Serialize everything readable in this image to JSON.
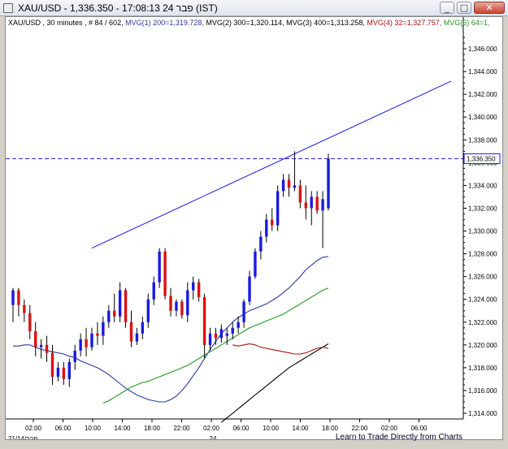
{
  "window": {
    "title": "XAU/USD - 1,336.350 - 17:08:13  פבר 24 (IST)"
  },
  "indicators": {
    "symbol": "XAU/USD , 30 minutes , # 84 / 602,",
    "mvg1": "MVG(1) 200=1,319.728,",
    "mvg2": "MVG(2) 300=1,320.114,",
    "mvg3": "MVG(3) 400=1,313.258,",
    "mvg4": "MVG(4) 32=1,327.757,",
    "mvg5": "MVG(5) 64=1,"
  },
  "colors": {
    "mvg1": "#2a3aa0",
    "mvg2": "#000000",
    "mvg3": "#000000",
    "mvg4": "#aa1111",
    "mvg5": "#229922",
    "up": "#1a1adf",
    "down": "#dd1111"
  },
  "price_label": "1,336.350",
  "bottom_link": "Learn to Trade Directly from Charts",
  "chart_data": {
    "type": "candlestick",
    "price_axis": {
      "min": 1313.5,
      "max": 1347.5,
      "ticks": [
        "1,314.000",
        "1,316.000",
        "1,318.000",
        "1,320.000",
        "1,322.000",
        "1,324.000",
        "1,326.000",
        "1,328.000",
        "1,330.000",
        "1,332.000",
        "1,334.000",
        "1,336.000",
        "1,338.000",
        "1,340.000",
        "1,342.000",
        "1,344.000",
        "1,346.000"
      ]
    },
    "time_axis": {
      "labels": [
        "02:00",
        "06:00",
        "10:00",
        "14:00",
        "18:00",
        "22:00",
        "02:00",
        "06:00",
        "10:00",
        "14:00",
        "18:00",
        "22:00",
        "02:00",
        "06:00"
      ],
      "date_labels": [
        "21/14/פבר",
        "24"
      ]
    },
    "current_price": 1336.35,
    "candles": [
      [
        1323.5,
        1325.0,
        1322.0,
        1324.8
      ],
      [
        1324.8,
        1325.0,
        1322.5,
        1323.5
      ],
      [
        1323.5,
        1324.0,
        1322.0,
        1322.8
      ],
      [
        1322.8,
        1323.5,
        1320.5,
        1321.2
      ],
      [
        1321.2,
        1322.0,
        1319.0,
        1319.8
      ],
      [
        1319.8,
        1320.5,
        1318.8,
        1320.0
      ],
      [
        1320.0,
        1320.8,
        1318.5,
        1319.3
      ],
      [
        1319.3,
        1320.0,
        1316.5,
        1317.2
      ],
      [
        1317.2,
        1318.5,
        1316.8,
        1318.0
      ],
      [
        1318.0,
        1318.5,
        1316.5,
        1317.0
      ],
      [
        1317.0,
        1318.8,
        1316.3,
        1318.5
      ],
      [
        1318.5,
        1320.0,
        1317.8,
        1319.5
      ],
      [
        1319.5,
        1321.0,
        1319.0,
        1320.5
      ],
      [
        1320.5,
        1321.5,
        1319.0,
        1319.8
      ],
      [
        1319.8,
        1321.5,
        1319.5,
        1321.0
      ],
      [
        1321.0,
        1322.0,
        1320.0,
        1320.8
      ],
      [
        1320.8,
        1322.5,
        1320.0,
        1322.0
      ],
      [
        1322.0,
        1323.5,
        1321.5,
        1323.0
      ],
      [
        1323.0,
        1324.5,
        1322.0,
        1322.5
      ],
      [
        1322.5,
        1325.5,
        1322.0,
        1324.8
      ],
      [
        1324.8,
        1325.0,
        1321.5,
        1322.0
      ],
      [
        1322.0,
        1323.0,
        1319.8,
        1320.3
      ],
      [
        1320.3,
        1321.5,
        1320.0,
        1321.0
      ],
      [
        1321.0,
        1322.5,
        1320.5,
        1322.0
      ],
      [
        1322.0,
        1324.5,
        1321.5,
        1324.0
      ],
      [
        1324.0,
        1326.0,
        1323.5,
        1325.5
      ],
      [
        1325.5,
        1328.5,
        1325.0,
        1328.2
      ],
      [
        1328.2,
        1328.5,
        1324.0,
        1324.3
      ],
      [
        1324.3,
        1325.0,
        1322.5,
        1323.0
      ],
      [
        1323.0,
        1324.0,
        1322.5,
        1323.8
      ],
      [
        1323.8,
        1324.0,
        1322.3,
        1322.6
      ],
      [
        1322.6,
        1325.5,
        1322.0,
        1324.8
      ],
      [
        1324.8,
        1326.0,
        1324.0,
        1325.5
      ],
      [
        1325.5,
        1325.8,
        1323.8,
        1324.2
      ],
      [
        1324.2,
        1324.5,
        1318.8,
        1320.0
      ],
      [
        1320.0,
        1321.5,
        1319.5,
        1321.0
      ],
      [
        1321.0,
        1321.5,
        1320.0,
        1320.6
      ],
      [
        1320.6,
        1321.8,
        1320.2,
        1321.4
      ],
      [
        1320.8,
        1321.5,
        1320.0,
        1321.0
      ],
      [
        1321.0,
        1322.0,
        1320.5,
        1321.5
      ],
      [
        1321.5,
        1322.5,
        1321.0,
        1322.0
      ],
      [
        1322.0,
        1324.0,
        1321.5,
        1323.8
      ],
      [
        1323.8,
        1326.5,
        1323.5,
        1326.0
      ],
      [
        1326.0,
        1328.5,
        1325.8,
        1328.2
      ],
      [
        1328.2,
        1330.0,
        1327.5,
        1329.5
      ],
      [
        1329.5,
        1331.5,
        1329.0,
        1331.0
      ],
      [
        1331.0,
        1332.0,
        1330.0,
        1330.5
      ],
      [
        1330.5,
        1334.0,
        1330.0,
        1333.5
      ],
      [
        1333.5,
        1335.0,
        1333.0,
        1334.5
      ],
      [
        1334.5,
        1335.0,
        1333.0,
        1333.8
      ],
      [
        1333.8,
        1337.0,
        1333.5,
        1334.0
      ],
      [
        1334.0,
        1334.5,
        1332.0,
        1332.5
      ],
      [
        1332.5,
        1334.0,
        1331.0,
        1332.0
      ],
      [
        1332.0,
        1333.5,
        1330.5,
        1333.0
      ],
      [
        1333.0,
        1333.5,
        1331.5,
        1331.8
      ],
      [
        1331.8,
        1333.5,
        1328.5,
        1332.8
      ],
      [
        1332.0,
        1336.8,
        1331.8,
        1336.35
      ]
    ],
    "moving_averages": [
      {
        "name": "MVG(1) 200",
        "color": "#2a3aa0",
        "values": [
          1319.9,
          1319.9,
          1320.0,
          1320.0,
          1319.8,
          1319.6,
          1319.5,
          1319.4,
          1319.3,
          1319.2,
          1319.0,
          1318.9,
          1318.6,
          1318.4,
          1318.2,
          1318.0,
          1317.7,
          1317.4,
          1317.0,
          1316.6,
          1316.2,
          1315.9,
          1315.6,
          1315.4,
          1315.2,
          1315.1,
          1315.0,
          1315.0,
          1315.2,
          1315.5,
          1316.0,
          1316.6,
          1317.3,
          1318.0,
          1318.8,
          1319.6,
          1320.3,
          1321.0,
          1321.5,
          1322.0,
          1322.4,
          1322.7,
          1323.0,
          1323.2,
          1323.4,
          1323.6,
          1323.9,
          1324.2,
          1324.6,
          1325.0,
          1325.5,
          1326.0,
          1326.6,
          1327.0,
          1327.4,
          1327.7,
          1327.757
        ]
      },
      {
        "name": "MVG(2) 300",
        "color": "#229922",
        "values": [
          1314.9,
          1315.1,
          1315.4,
          1315.7,
          1316.0,
          1316.3,
          1316.5,
          1316.7,
          1316.8,
          1317.0,
          1317.2,
          1317.4,
          1317.6,
          1317.8,
          1318.0,
          1318.2,
          1318.5,
          1318.8,
          1319.1,
          1319.4,
          1319.7,
          1320.0,
          1320.3,
          1320.6,
          1320.9,
          1321.2,
          1321.5,
          1321.7,
          1321.9,
          1322.1,
          1322.3,
          1322.5,
          1322.7,
          1323.0,
          1323.3,
          1323.6,
          1323.9,
          1324.2,
          1324.5,
          1324.8,
          1325.0
        ]
      },
      {
        "name": "MVG(3) 400",
        "color": "#000000",
        "values": [
          1313.2,
          1313.6,
          1314.0,
          1314.4,
          1314.8,
          1315.2,
          1315.6,
          1316.0,
          1316.4,
          1316.8,
          1317.2,
          1317.6,
          1318.0,
          1318.3,
          1318.6,
          1318.9,
          1319.2,
          1319.5,
          1319.8,
          1320.1
        ]
      },
      {
        "name": "MVG(4) 32",
        "color": "#aa1111",
        "values": [
          1320.0,
          1319.9,
          1320.0,
          1320.1,
          1320.0,
          1319.8,
          1319.7,
          1319.6,
          1319.5,
          1319.4,
          1319.3,
          1319.2,
          1319.2,
          1319.3,
          1319.5,
          1319.7,
          1319.8,
          1319.7
        ]
      },
      {
        "name": "MVG(5) 64",
        "color": "#229922",
        "values": []
      }
    ]
  }
}
